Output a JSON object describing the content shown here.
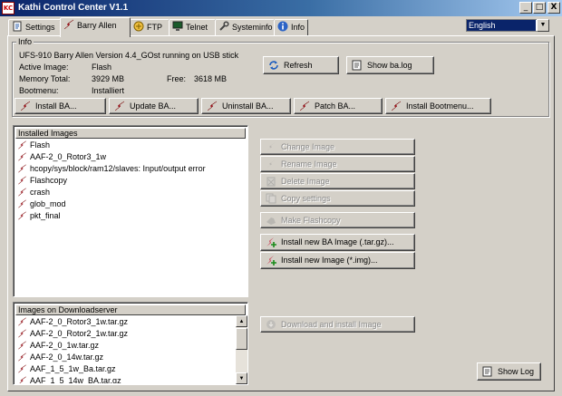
{
  "window": {
    "title": "Kathi Control Center V1.1",
    "icon_text": "KC",
    "controls": {
      "minimize": "_",
      "maximize": "□",
      "close": "X"
    }
  },
  "tabs": [
    {
      "label": "Settings",
      "icon": "settings-doc-icon"
    },
    {
      "label": "Barry Allen",
      "icon": "flash-icon"
    },
    {
      "label": "FTP",
      "icon": "ftp-icon"
    },
    {
      "label": "Telnet",
      "icon": "monitor-icon"
    },
    {
      "label": "Systeminfo",
      "icon": "wrench-icon"
    },
    {
      "label": "Info",
      "icon": "info-icon"
    }
  ],
  "language": {
    "selected": "English",
    "arrow": "▼"
  },
  "info": {
    "legend": "Info",
    "version_line": "UFS-910 Barry Allen Version 4.4_GOst running on USB stick",
    "active_image_label": "Active Image:",
    "active_image_value": "Flash",
    "memory_total_label": "Memory Total:",
    "memory_total_value": "3929 MB",
    "free_label": "Free:",
    "free_value": "3618 MB",
    "bootmenu_label": "Bootmenu:",
    "bootmenu_value": "Installiert",
    "refresh_button": "Refresh",
    "show_balog_button": "Show ba.log"
  },
  "action_buttons": {
    "install_ba": "Install BA...",
    "update_ba": "Update BA...",
    "uninstall_ba": "Uninstall BA...",
    "patch_ba": "Patch BA...",
    "install_bootmenu": "Install Bootmenu..."
  },
  "installed_images": {
    "header": "Installed Images",
    "items": [
      "Flash",
      "AAF-2_0_Rotor3_1w",
      "hcopy/sys/block/ram12/slaves: Input/output error",
      "Flashcopy",
      "crash",
      "glob_mod",
      "pkt_final"
    ]
  },
  "image_buttons": {
    "change_image": "Change Image",
    "rename_image": "Rename Image",
    "delete_image": "Delete Image",
    "copy_settings": "Copy settings",
    "make_flashcopy": "Make Flashcopy",
    "install_new_ba_image": "Install new BA Image (.tar.gz)...",
    "install_new_image": "Install new Image (*.img)..."
  },
  "download_images": {
    "header": "Images on Downloadserver",
    "items": [
      "AAF-2_0_Rotor3_1w.tar.gz",
      "AAF-2_0_Rotor2_1w.tar.gz",
      "AAF-2_0_1w.tar.gz",
      "AAF-2_0_14w.tar.gz",
      "AAF_1_5_1w_Ba.tar.gz",
      "AAF_1_5_14w_BA.tar.gz"
    ],
    "scroll_up": "▲",
    "scroll_down": "▼"
  },
  "download_button": "Download and install Image",
  "show_log_button": "Show Log",
  "colors": {
    "titlebar": "#0a246a",
    "face": "#d4d0c8",
    "flash_red": "#c8102e"
  }
}
